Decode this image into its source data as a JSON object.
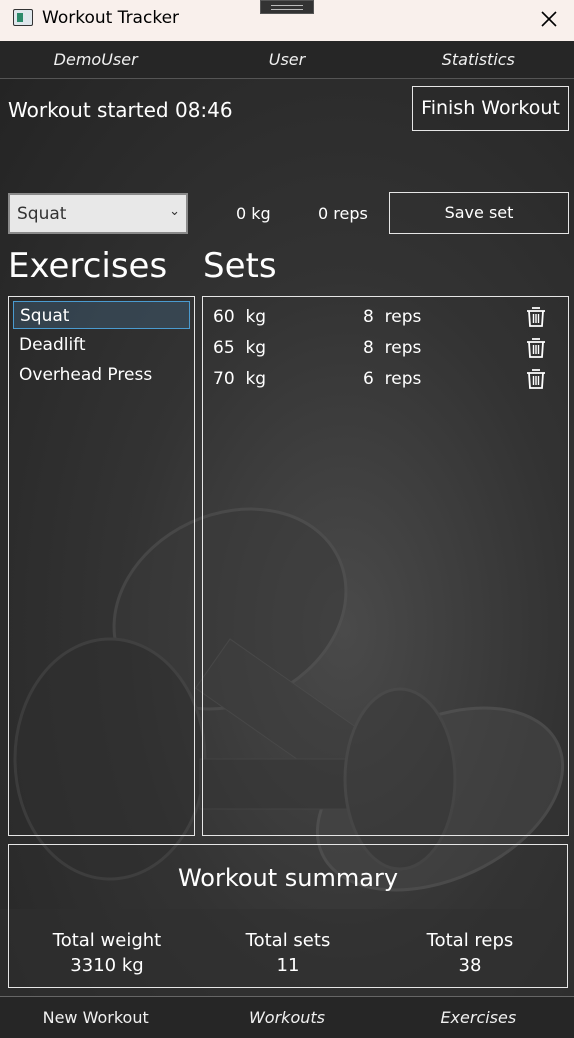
{
  "window": {
    "title": "Workout Tracker"
  },
  "top_nav": [
    {
      "label": "DemoUser"
    },
    {
      "label": "User"
    },
    {
      "label": "Statistics"
    }
  ],
  "workout": {
    "started_label": "Workout started 08:46",
    "finish_label": "Finish Workout"
  },
  "entry": {
    "exercise_selected": "Squat",
    "weight": "0 kg",
    "reps": "0 reps",
    "save_label": "Save set"
  },
  "exercises": {
    "heading": "Exercises",
    "items": [
      {
        "label": "Squat",
        "selected": true
      },
      {
        "label": "Deadlift"
      },
      {
        "label": "Overhead Press"
      }
    ]
  },
  "sets": {
    "heading": "Sets",
    "rows": [
      {
        "weight": "60  kg",
        "reps": "8  reps"
      },
      {
        "weight": "65  kg",
        "reps": "8  reps"
      },
      {
        "weight": "70  kg",
        "reps": "6  reps"
      }
    ]
  },
  "summary": {
    "title": "Workout summary",
    "total_weight_label": "Total weight",
    "total_weight_value": "3310 kg",
    "total_sets_label": "Total sets",
    "total_sets_value": "11",
    "total_reps_label": "Total reps",
    "total_reps_value": "38"
  },
  "bottom_nav": [
    {
      "label": "New Workout"
    },
    {
      "label": "Workouts"
    },
    {
      "label": "Exercises"
    }
  ],
  "icons": {
    "app": "app-icon",
    "close": "close-icon",
    "delete": "trash-icon",
    "dropdown": "chevron-down-icon"
  }
}
